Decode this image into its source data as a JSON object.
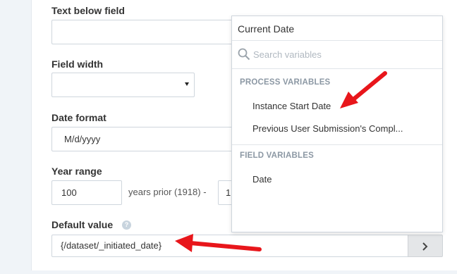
{
  "form": {
    "text_below_label": "Text below field",
    "text_below_value": "",
    "field_width_label": "Field width",
    "field_width_value": "",
    "date_format_label": "Date format",
    "date_format_value": "M/d/yyyy",
    "year_range_label": "Year range",
    "year_range_prior_value": "100",
    "year_range_prior_text": "years prior (1918) -",
    "year_range_after_value": "1",
    "default_value_label": "Default value",
    "default_value_help_icon": "question-circle-icon",
    "default_value_value": "{/dataset/_initiated_date}",
    "variable_button_icon": "chevron-right-icon"
  },
  "dropdown": {
    "title": "Current Date",
    "search_placeholder": "Search variables",
    "groups": [
      {
        "label": "PROCESS VARIABLES",
        "items": [
          "Instance Start Date",
          "Previous User Submission's Compl..."
        ]
      },
      {
        "label": "FIELD VARIABLES",
        "items": [
          "Date"
        ]
      }
    ]
  },
  "colors": {
    "annotation_arrow": "#e8161b",
    "panel_background": "#ffffff",
    "page_background": "#f0f4f8"
  }
}
